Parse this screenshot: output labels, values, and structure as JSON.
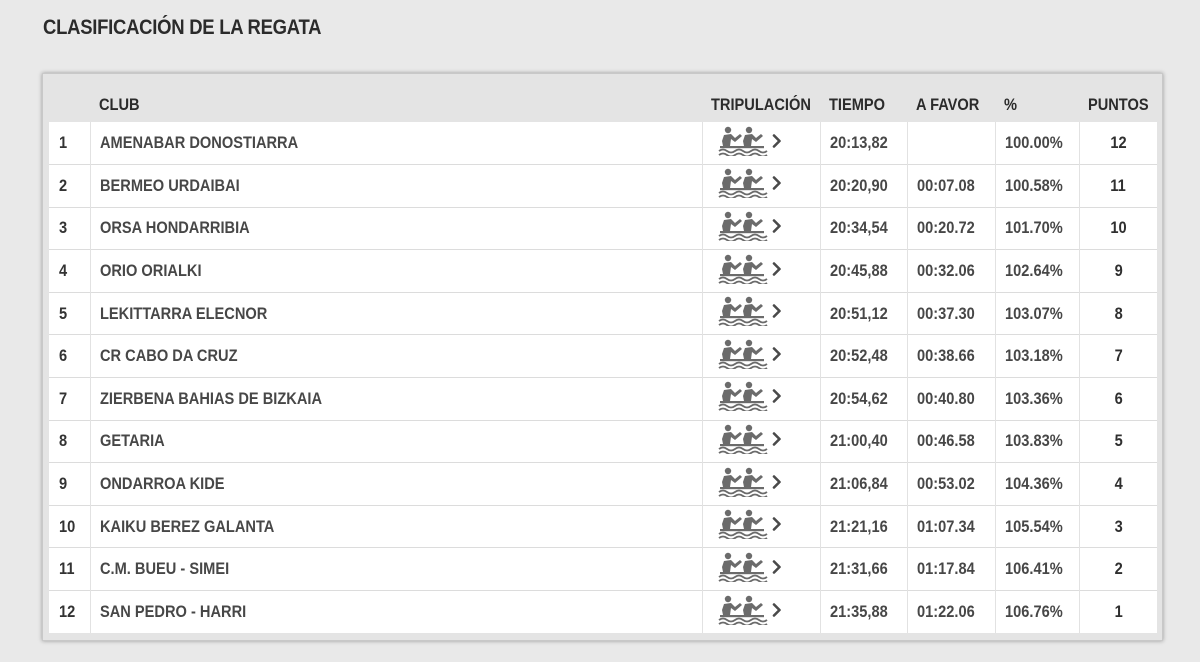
{
  "page": {
    "title": "CLASIFICACIÓN DE LA REGATA"
  },
  "table": {
    "headers": {
      "position": "",
      "club": "CLUB",
      "crew": "TRIPULACIÓN",
      "time": "TIEMPO",
      "gap": "A FAVOR",
      "percent": "%",
      "points": "PUNTOS"
    },
    "crew_icon": "rowing-crew-icon",
    "link_icon": "chevron-right-icon",
    "rows": [
      {
        "position": "1",
        "club": "AMENABAR DONOSTIARRA",
        "time": "20:13,82",
        "gap": "",
        "percent": "100.00%",
        "points": "12"
      },
      {
        "position": "2",
        "club": "BERMEO URDAIBAI",
        "time": "20:20,90",
        "gap": "00:07.08",
        "percent": "100.58%",
        "points": "11"
      },
      {
        "position": "3",
        "club": "ORSA HONDARRIBIA",
        "time": "20:34,54",
        "gap": "00:20.72",
        "percent": "101.70%",
        "points": "10"
      },
      {
        "position": "4",
        "club": "ORIO ORIALKI",
        "time": "20:45,88",
        "gap": "00:32.06",
        "percent": "102.64%",
        "points": "9"
      },
      {
        "position": "5",
        "club": "LEKITTARRA ELECNOR",
        "time": "20:51,12",
        "gap": "00:37.30",
        "percent": "103.07%",
        "points": "8"
      },
      {
        "position": "6",
        "club": "CR CABO DA CRUZ",
        "time": "20:52,48",
        "gap": "00:38.66",
        "percent": "103.18%",
        "points": "7"
      },
      {
        "position": "7",
        "club": "ZIERBENA BAHIAS DE BIZKAIA",
        "time": "20:54,62",
        "gap": "00:40.80",
        "percent": "103.36%",
        "points": "6"
      },
      {
        "position": "8",
        "club": "GETARIA",
        "time": "21:00,40",
        "gap": "00:46.58",
        "percent": "103.83%",
        "points": "5"
      },
      {
        "position": "9",
        "club": "ONDARROA KIDE",
        "time": "21:06,84",
        "gap": "00:53.02",
        "percent": "104.36%",
        "points": "4"
      },
      {
        "position": "10",
        "club": "KAIKU BEREZ GALANTA",
        "time": "21:21,16",
        "gap": "01:07.34",
        "percent": "105.54%",
        "points": "3"
      },
      {
        "position": "11",
        "club": "C.M. BUEU - SIMEI",
        "time": "21:31,66",
        "gap": "01:17.84",
        "percent": "106.41%",
        "points": "2"
      },
      {
        "position": "12",
        "club": "SAN PEDRO - HARRI",
        "time": "21:35,88",
        "gap": "01:22.06",
        "percent": "106.76%",
        "points": "1"
      }
    ]
  },
  "colors": {
    "background": "#e9e9e9",
    "row_background": "#ffffff",
    "text": "#474747",
    "icon": "#6b6b6b"
  }
}
